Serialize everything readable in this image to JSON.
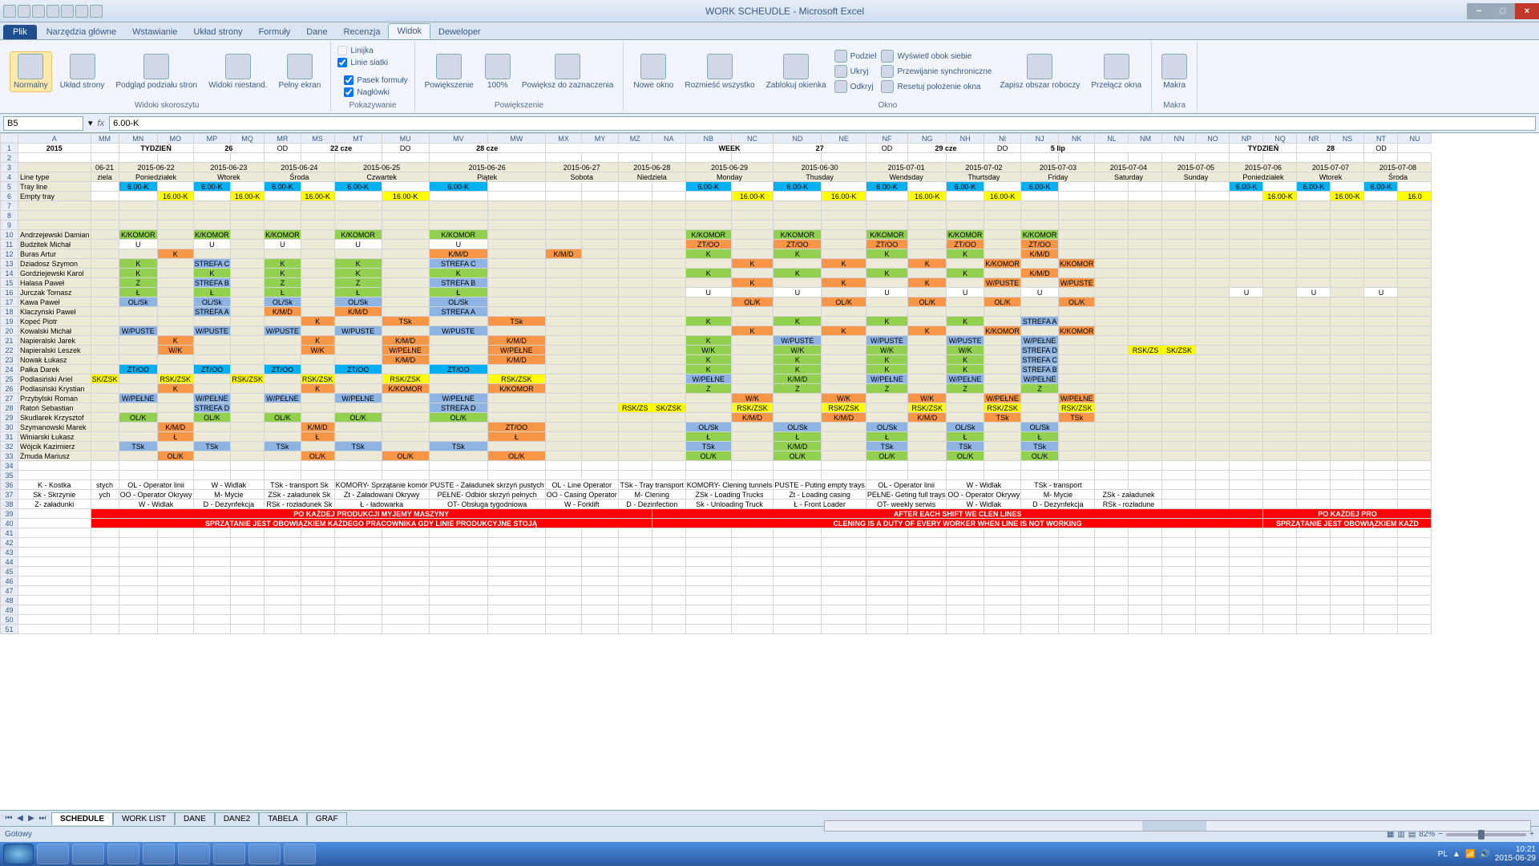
{
  "window": {
    "title": "WORK SCHEUDLE - Microsoft Excel"
  },
  "tabs": {
    "file": "Plik",
    "items": [
      "Narzędzia główne",
      "Wstawianie",
      "Układ strony",
      "Formuły",
      "Dane",
      "Recenzja",
      "Widok",
      "Deweloper"
    ],
    "active": 6
  },
  "ribbon": {
    "g1": {
      "label": "Widoki skoroszytu",
      "normal": "Normalny",
      "layout": "Układ strony",
      "pagebreak": "Podgląd podziału stron",
      "custom": "Widoki niestand.",
      "full": "Pełny ekran"
    },
    "g2": {
      "label": "Pokazywanie",
      "ruler": "Linijka",
      "formula": "Pasek formuły",
      "grid": "Linie siatki",
      "headings": "Nagłówki"
    },
    "g3": {
      "label": "Powiększenie",
      "zoom": "Powiększenie",
      "z100": "100%",
      "zsel": "Powiększ do zaznaczenia"
    },
    "g4": {
      "label": "Okno",
      "new": "Nowe okno",
      "all": "Rozmieść wszystko",
      "freeze": "Zablokuj okienka",
      "split": "Podziel",
      "hide": "Ukryj",
      "unhide": "Odkryj",
      "side": "Wyświetl obok siebie",
      "sync": "Przewijanie synchroniczne",
      "reset": "Resetuj położenie okna",
      "save": "Zapisz obszar roboczy",
      "switch": "Przełącz okna"
    },
    "g5": {
      "label": "Makra",
      "macros": "Makra"
    }
  },
  "formula": {
    "cell": "B5",
    "value": "6.00-K"
  },
  "colheads": [
    "A",
    "MM",
    "MN",
    "MO",
    "MP",
    "MQ",
    "MR",
    "MS",
    "MT",
    "MU",
    "MV",
    "MW",
    "MX",
    "MY",
    "MZ",
    "NA",
    "NB",
    "NC",
    "ND",
    "NE",
    "NF",
    "NG",
    "NH",
    "NI",
    "NJ",
    "NK",
    "NL",
    "NM",
    "NN",
    "NO",
    "NP",
    "NQ",
    "NR",
    "NS",
    "NT",
    "NU"
  ],
  "rowheads": [
    "1",
    "2",
    "3",
    "4",
    "5",
    "6",
    "7",
    "8",
    "9",
    "10",
    "11",
    "12",
    "13",
    "14",
    "15",
    "16",
    "17",
    "18",
    "19",
    "20",
    "21",
    "22",
    "23",
    "24",
    "25",
    "26",
    "27",
    "28",
    "29",
    "30",
    "31",
    "32",
    "33",
    "34",
    "35",
    "36",
    "37",
    "38",
    "39",
    "40",
    "41",
    "42",
    "43",
    "44",
    "45",
    "46",
    "47",
    "48",
    "49",
    "50",
    "51"
  ],
  "row1": {
    "year": "2015",
    "w1a": "TYDZIEŃ",
    "w1b": "26",
    "od1": "OD",
    "d1": "22 cze",
    "do1": "DO",
    "d2": "28 cze",
    "w2a": "WEEK",
    "w2b": "27",
    "od2": "OD",
    "d3": "29 cze",
    "do2": "DO",
    "d4": "5 lip",
    "w3a": "TYDZIEŃ",
    "w3b": "28",
    "od3": "OD"
  },
  "row3": [
    "06-21",
    "2015-06-22",
    "2015-06-23",
    "2015-06-24",
    "2015-06-25",
    "2015-06-26",
    "2015-06-27",
    "2015-06-28",
    "2015-06-29",
    "2015-06-30",
    "2015-07-01",
    "2015-07-02",
    "2015-07-03",
    "2015-07-04",
    "2015-07-05",
    "2015-07-06",
    "2015-07-07",
    "2015-07-08"
  ],
  "row4l": "Line type",
  "row4": [
    "ziela",
    "Poniedziałek",
    "Wtorek",
    "Środa",
    "Czwartek",
    "Piątek",
    "Sobota",
    "Niedziela",
    "Monday",
    "Thusday",
    "Wendsday",
    "Thurtsday",
    "Friday",
    "Saturday",
    "Sunday",
    "Poniedziałek",
    "Wtorek",
    "Środa"
  ],
  "row5l": "Tray line",
  "row6l": "Empty tray",
  "k600": "6.00-K",
  "k1600": "16.00-K",
  "names": [
    "Andrzejewski Damian",
    "Budzitek Michał",
    "Buras Artur",
    "Dziadosz Szymon",
    "Gordziejewski Karol",
    "Halasa Paweł",
    "Jurczak Tomasz",
    "Kawa Paweł",
    "Klaczyński Paweł",
    "Kopeć Piotr",
    "Kowalski Michał",
    "Napieralski Jarek",
    "Napieralski Leszek",
    "Nowak Łukasz",
    "Pałka Darek",
    "Podlasiński Ariel",
    "Podlasiński Krystian",
    "Przybylski Roman",
    "Ratoń Sebastian",
    "Skudlarek Krzysztof",
    "Szymanowski Marek",
    "Winiarski Łukasz",
    "Wójcik Kazimierz",
    "Żmuda Mariusz"
  ],
  "codes": {
    "KKOMOR": "K/KOMOR",
    "U": "U",
    "K": "K",
    "KMD": "K/M/D",
    "STREFAC": "STREFA C",
    "STREFAB": "STREFA B",
    "STREFAA": "STREFA A",
    "STREFAD": "STREFA D",
    "Z": "Z",
    "L": "Ł",
    "OLSK": "OL/Sk",
    "WPUSTE": "W/PUSTE",
    "WK": "W/K",
    "WPELNE": "W/PEŁNE",
    "ZTOO": "ZT/OO",
    "RSKZSK": "RSK/ZSK",
    "TSK": "TSk",
    "OLK": "OL/K",
    "SKZSK": "SK/ZSK",
    "KKOMOR2": "K/KOMOR",
    "RSKZS": "RSK/ZS"
  },
  "legend1": [
    "K - Kostka",
    "stych",
    "OL - Operator linii",
    "W - Widlak",
    "TSk - transport Sk",
    "KOMORY- Sprzątanie komór",
    "PUSTE - Załadunek skrzyń pustych",
    "OL - Line Operator",
    "TSk - Tray transport",
    "KOMORY- Clening tunnels",
    "PUSTE - Puting empty trays",
    "OL - Operator linii",
    "W - Widlak",
    "TSk - transport"
  ],
  "legend2": [
    "Sk - Skrzynie",
    "ych",
    "OO - Operator Okrywy",
    "M- Mycie",
    "ZSk - załadunek Sk",
    "Zt - Załadowani Okrywy",
    "PEŁNE- Odbiór skrzyń pełnych",
    "OO - Casing Operator",
    "M- Clening",
    "ZSk - Loading Trucks",
    "Zt - Loading casing",
    "PEŁNE- Geting full trays",
    "OO - Operator Okrywy",
    "M- Mycie",
    "ZSk - załadunek"
  ],
  "legend3": [
    "Z- załadunki",
    "",
    "W - Widlak",
    "D - Dezynfekcja",
    "RSk - rozładunek Sk",
    "Ł - ładowarka",
    "OT- Obsługa tygodniowa",
    "W - Forklift",
    "D - Dezinfection",
    "Sk - Unloading Truck",
    "Ł - Front Loader",
    "OT- weekly serwis",
    "W - Widlak",
    "D - Dezynfekcja",
    "RSk - rozładune"
  ],
  "banner1a": "PO KAŻDEJ PRODUKCJI MYJEMY MASZYNY",
  "banner1b": "AFTER EACH SHIFT WE CLEN LINES",
  "banner1c": "PO KAŻDEJ PRO",
  "banner2a": "SPRZĄTANIE JEST OBOWIĄZKIEM KAŻDEGO PRACOWNIKA GDY LINIE PRODUKCYJNE STOJĄ",
  "banner2b": "CLENING IS A DUTY OF EVERY WORKER WHEN LINE IS NOT WORKING",
  "banner2c": "SPRZĄTANIE JEST OBOWIĄZKIEM KAŻD",
  "sheets": [
    "SCHEDULE",
    "WORK LIST",
    "DANE",
    "DANE2",
    "TABELA",
    "GRAF"
  ],
  "status": {
    "ready": "Gotowy",
    "zoom": "82%"
  },
  "taskbar": {
    "lang": "PL",
    "time": "10:21",
    "date": "2015-06-29"
  }
}
